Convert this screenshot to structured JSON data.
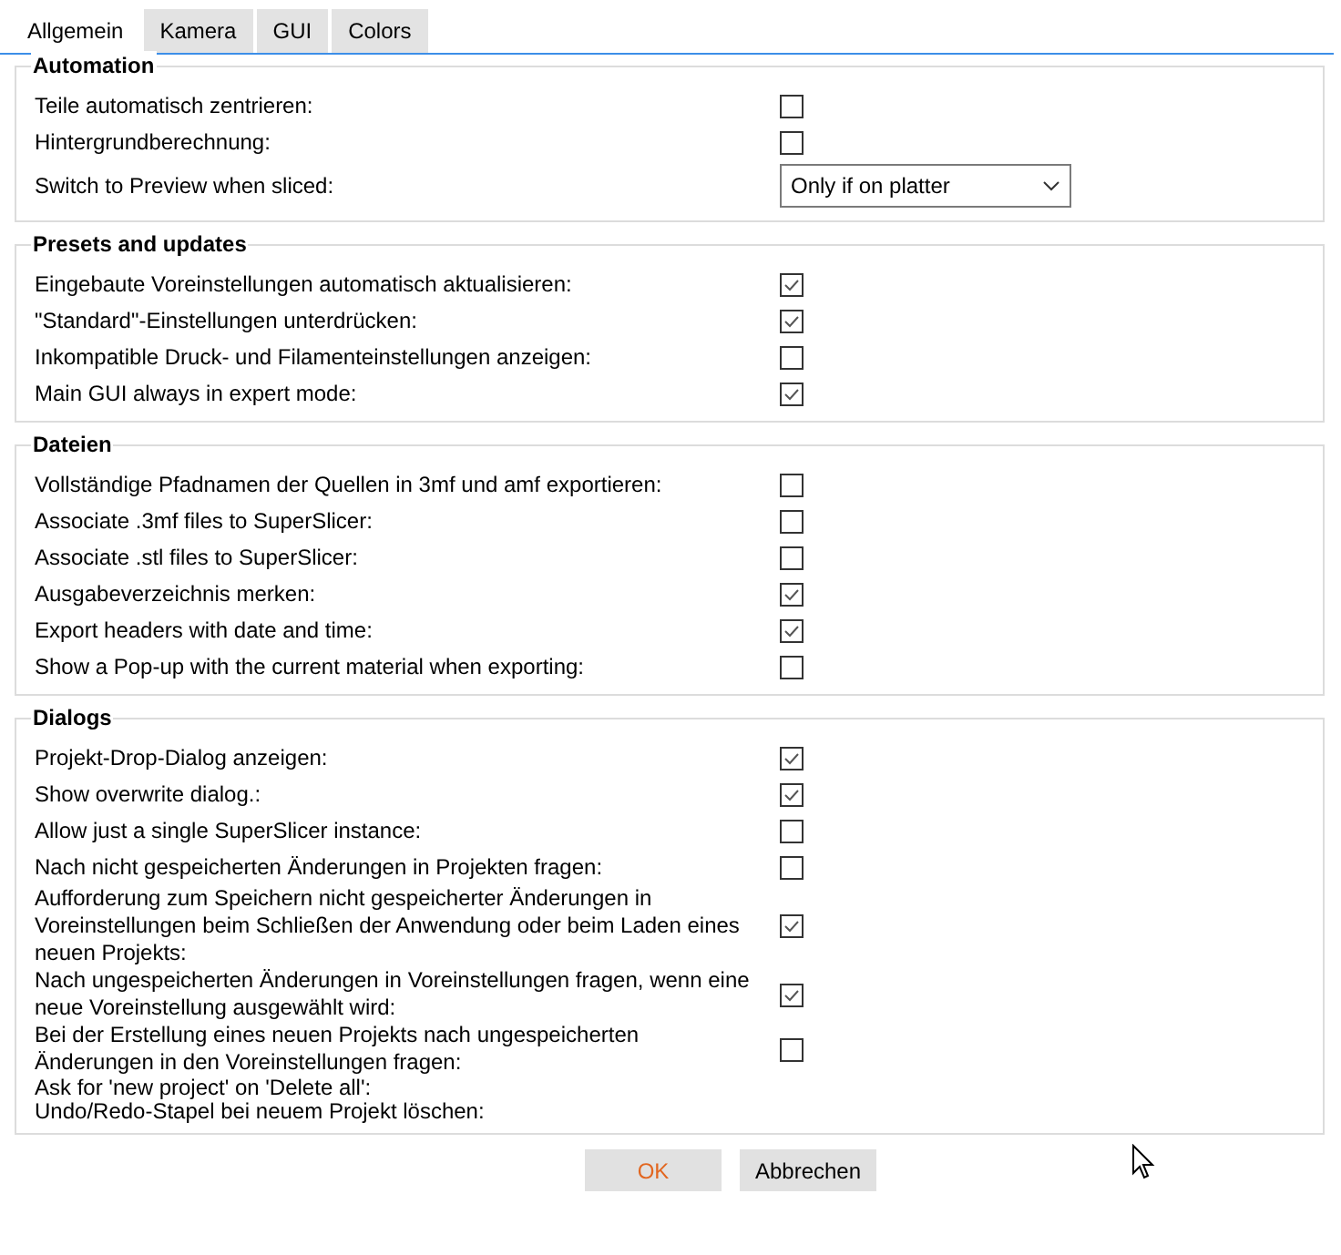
{
  "tabs": [
    {
      "label": "Allgemein",
      "selected": true
    },
    {
      "label": "Kamera",
      "selected": false
    },
    {
      "label": "GUI",
      "selected": false
    },
    {
      "label": "Colors",
      "selected": false
    }
  ],
  "groups": [
    {
      "title": "Automation",
      "rows": [
        {
          "kind": "checkbox",
          "label": "Teile automatisch zentrieren:",
          "checked": false
        },
        {
          "kind": "checkbox",
          "label": "Hintergrundberechnung:",
          "checked": false
        },
        {
          "kind": "dropdown",
          "label": "Switch to Preview when sliced:",
          "value": "Only if on platter"
        }
      ]
    },
    {
      "title": "Presets and updates",
      "rows": [
        {
          "kind": "checkbox",
          "label": "Eingebaute Voreinstellungen automatisch aktualisieren:",
          "checked": true
        },
        {
          "kind": "checkbox",
          "label": "\"Standard\"-Einstellungen unterdrücken:",
          "checked": true
        },
        {
          "kind": "checkbox",
          "label": "Inkompatible Druck- und Filamenteinstellungen anzeigen:",
          "checked": false
        },
        {
          "kind": "checkbox",
          "label": "Main GUI always in expert mode:",
          "checked": true
        }
      ]
    },
    {
      "title": "Dateien",
      "rows": [
        {
          "kind": "checkbox",
          "label": "Vollständige Pfadnamen der Quellen in 3mf und amf exportieren:",
          "checked": false
        },
        {
          "kind": "checkbox",
          "label": "Associate .3mf files to SuperSlicer:",
          "checked": false
        },
        {
          "kind": "checkbox",
          "label": "Associate .stl files to SuperSlicer:",
          "checked": false
        },
        {
          "kind": "checkbox",
          "label": "Ausgabeverzeichnis merken:",
          "checked": true
        },
        {
          "kind": "checkbox",
          "label": "Export headers with date and time:",
          "checked": true
        },
        {
          "kind": "checkbox",
          "label": "Show a Pop-up with the current material when exporting:",
          "checked": false
        }
      ]
    },
    {
      "title": "Dialogs",
      "rows": [
        {
          "kind": "checkbox",
          "label": "Projekt-Drop-Dialog anzeigen:",
          "checked": true
        },
        {
          "kind": "checkbox",
          "label": "Show overwrite dialog.:",
          "checked": true
        },
        {
          "kind": "checkbox",
          "label": "Allow just a single SuperSlicer instance:",
          "checked": false
        },
        {
          "kind": "checkbox",
          "label": "Nach nicht gespeicherten Änderungen in Projekten fragen:",
          "checked": false
        },
        {
          "kind": "checkbox",
          "label": "Aufforderung zum Speichern nicht gespeicherter Änderungen in Voreinstellungen beim Schließen der Anwendung oder beim Laden eines neuen Projekts:",
          "checked": true
        },
        {
          "kind": "checkbox",
          "label": "Nach ungespeicherten Änderungen in Voreinstellungen fragen, wenn eine neue Voreinstellung ausgewählt wird:",
          "checked": true
        },
        {
          "kind": "checkbox",
          "label": "Bei der Erstellung eines neuen Projekts nach ungespeicherten Änderungen in den Voreinstellungen fragen:",
          "checked": false
        },
        {
          "kind": "text",
          "label": "Ask for 'new project' on 'Delete all':"
        },
        {
          "kind": "text",
          "label": "Undo/Redo-Stapel bei neuem Projekt löschen:"
        }
      ]
    }
  ],
  "buttons": [
    {
      "label": "OK",
      "default": true
    },
    {
      "label": "Abbrechen",
      "default": false
    }
  ]
}
